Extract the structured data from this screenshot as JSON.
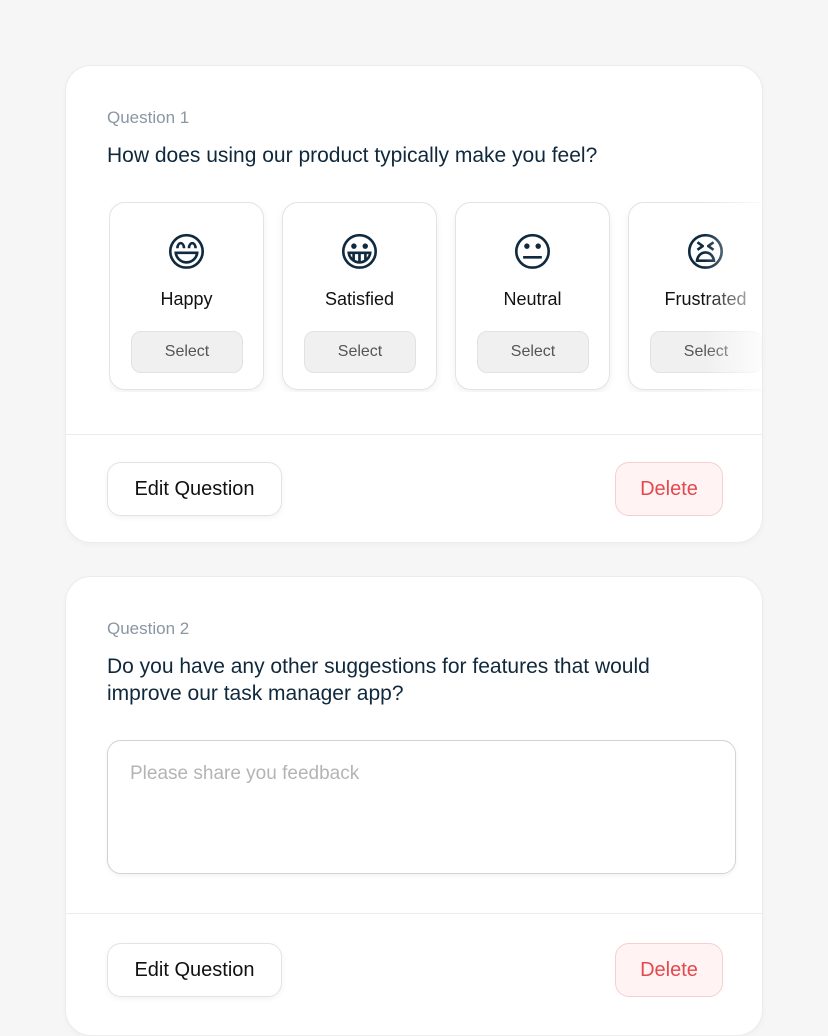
{
  "questions": [
    {
      "number_label": "Question 1",
      "text": "How does using our product typically make you feel?",
      "options": [
        {
          "emoji": "😄",
          "icon": "grinning-face-icon",
          "label": "Happy",
          "button": "Select"
        },
        {
          "emoji": "😀",
          "icon": "smiling-face-icon",
          "label": "Satisfied",
          "button": "Select"
        },
        {
          "emoji": "😐",
          "icon": "neutral-face-icon",
          "label": "Neutral",
          "button": "Select"
        },
        {
          "emoji": "😫",
          "icon": "tired-face-icon",
          "label": "Frustrated",
          "button": "Select"
        }
      ],
      "edit_label": "Edit Question",
      "delete_label": "Delete"
    },
    {
      "number_label": "Question 2",
      "text": "Do you have any other suggestions for features that would improve our task manager app?",
      "input": {
        "value": "",
        "placeholder": "Please share you feedback"
      },
      "edit_label": "Edit Question",
      "delete_label": "Delete"
    }
  ],
  "colors": {
    "background": "#f6f6f6",
    "card": "#ffffff",
    "question_number": "#8a96a3",
    "question_text": "#10283b",
    "delete_text": "#e5484d",
    "delete_bg": "#fff3f3"
  }
}
